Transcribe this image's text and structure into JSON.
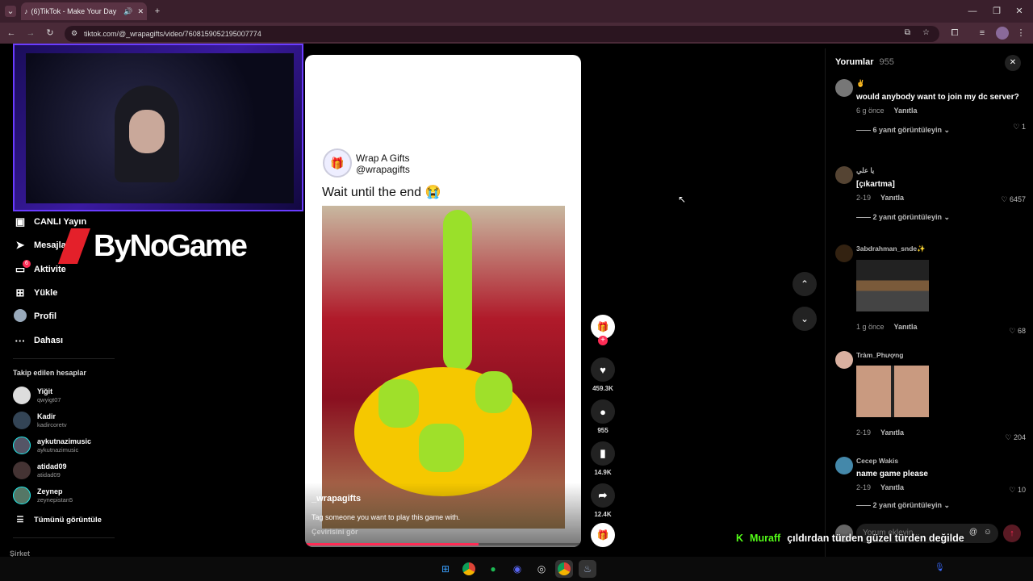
{
  "browser": {
    "tab_title": "(6)TikTok - Make Your Day",
    "url": "tiktok.com/@_wrapagifts/video/7608159052195007774"
  },
  "nav": {
    "items": [
      {
        "label": "CANLI Yayın"
      },
      {
        "label": "Mesajlar"
      },
      {
        "label": "Aktivite",
        "badge": "6"
      },
      {
        "label": "Yükle"
      },
      {
        "label": "Profil"
      },
      {
        "label": "Dahası"
      }
    ],
    "followed_title": "Takip edilen hesaplar",
    "accounts": [
      {
        "name": "Yiğit",
        "user": "qwyigt07"
      },
      {
        "name": "Kadir",
        "user": "kadircoretv"
      },
      {
        "name": "aykutnazimusic",
        "user": "aykutnazimusic"
      },
      {
        "name": "atidad09",
        "user": "atidad09"
      },
      {
        "name": "Zeynep",
        "user": "zeynepistan5"
      }
    ],
    "see_all": "Tümünü görüntüle",
    "footer": "Şirket"
  },
  "overlay": {
    "brand": "ByNoGame",
    "chat_user": "Muraff",
    "chat_message": "çıldırdan türden güzel türden değilde"
  },
  "video": {
    "poster_name": "Wrap A Gifts",
    "poster_handle": "@wrapagifts",
    "caption": "Wait until the end 😭",
    "overlay_user": "_wrapagifts",
    "overlay_desc": "Tag someone you want to play this game with.",
    "translate": "Çevirisini gör",
    "progress": 0.63
  },
  "actions": {
    "likes": "459.3K",
    "comments": "955",
    "saves": "14.9K",
    "shares": "12.4K"
  },
  "comments_panel": {
    "title": "Yorumlar",
    "count": "955",
    "reply_label": "Yanıtla",
    "input_placeholder": "Yorum ekleyin...",
    "items": [
      {
        "name": "✌",
        "text": "would anybody want to join my dc server?",
        "time": "6 g önce",
        "likes": "1",
        "more": "6 yanıt görüntüleyin"
      },
      {
        "name": "يا علي",
        "text": "[çıkartma]",
        "time": "2-19",
        "likes": "6457",
        "more": "2 yanıt görüntüleyin"
      },
      {
        "name": "3abdrahman_snde✨",
        "text": "",
        "time": "1 g önce",
        "likes": "68",
        "more": ""
      },
      {
        "name": "Tràm_Phượng",
        "text": "",
        "time": "2-19",
        "likes": "204",
        "more": ""
      },
      {
        "name": "Cecep Wakis",
        "text": "name game please",
        "time": "2-19",
        "likes": "10",
        "more": "2 yanıt görüntüleyin"
      }
    ]
  },
  "colors": {
    "accent": "#fe2c55",
    "chrome": "#3a1f2c",
    "chat_user": "#53fc18"
  }
}
